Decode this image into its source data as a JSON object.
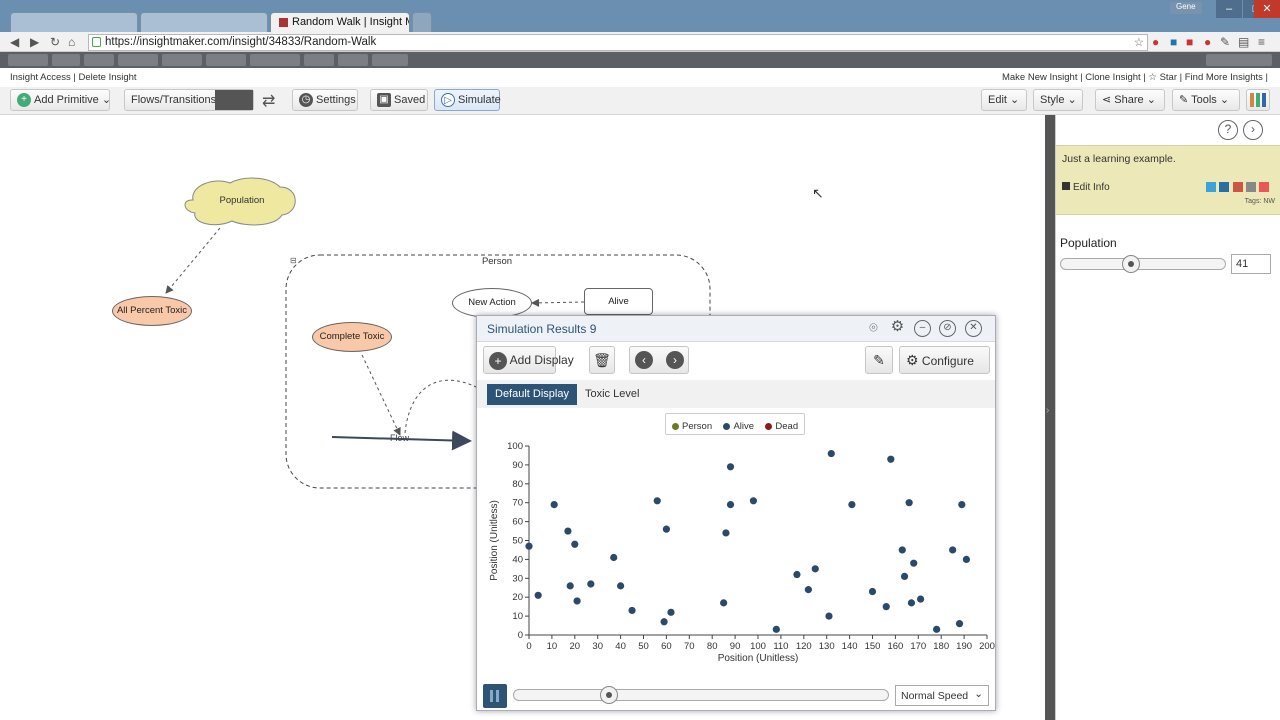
{
  "browser": {
    "tabs": [
      {
        "label": "",
        "active": false
      },
      {
        "label": "",
        "active": false
      },
      {
        "label": "Random Walk | Insight Ma",
        "active": true
      }
    ],
    "user_badge": "Gene",
    "url": "https://insightmaker.com/insight/34833/Random-Walk"
  },
  "app_links": {
    "left": "Insight Access | Delete Insight",
    "right": "Make New Insight | Clone Insight | ☆ Star | Find More Insights |"
  },
  "toolbar": {
    "add_primitive": "Add Primitive",
    "flows_transitions": "Flows/Transitions",
    "settings": "Settings",
    "saved": "Saved",
    "simulate": "Simulate",
    "edit": "Edit",
    "style": "Style",
    "share": "Share",
    "tools": "Tools"
  },
  "model": {
    "population": "Population",
    "all_percent_toxic": "All Percent Toxic",
    "person": "Person",
    "new_action": "New Action",
    "alive": "Alive",
    "complete_toxic": "Complete Toxic",
    "flow": "Flow"
  },
  "right_panel": {
    "description": "Just a learning example.",
    "edit_info": "Edit Info",
    "tags": "Tags: NW",
    "slider_label": "Population",
    "slider_value": "41",
    "slider_fraction": 0.41
  },
  "results": {
    "title": "Simulation Results 9",
    "add_display": "Add Display",
    "configure": "Configure",
    "tabs": [
      "Default Display",
      "Toxic Level"
    ],
    "speed": "Normal Speed",
    "progress_fraction": 0.24
  },
  "colors": {
    "person": "#6b7a1e",
    "alive": "#2b4a6b",
    "dead": "#8b1c1c",
    "population_fill": "#eee8a0",
    "toxic_fill": "#f9c8a8",
    "tab_active": "#2d5377"
  },
  "chart_data": {
    "type": "scatter",
    "title": "",
    "xlabel": "Position (Unitless)",
    "ylabel": "Position (Unitless)",
    "xlim": [
      0,
      200
    ],
    "ylim": [
      0,
      100
    ],
    "xticks": [
      0,
      10,
      20,
      30,
      40,
      50,
      60,
      70,
      80,
      90,
      100,
      110,
      120,
      130,
      140,
      150,
      160,
      170,
      180,
      190,
      200
    ],
    "yticks": [
      0,
      10,
      20,
      30,
      40,
      50,
      60,
      70,
      80,
      90,
      100
    ],
    "legend": [
      "Person",
      "Alive",
      "Dead"
    ],
    "legend_position": "top-center",
    "series": [
      {
        "name": "Alive",
        "points": [
          [
            0,
            47
          ],
          [
            4,
            21
          ],
          [
            11,
            69
          ],
          [
            17,
            55
          ],
          [
            18,
            26
          ],
          [
            20,
            48
          ],
          [
            21,
            18
          ],
          [
            27,
            27
          ],
          [
            37,
            41
          ],
          [
            40,
            26
          ],
          [
            45,
            13
          ],
          [
            56,
            71
          ],
          [
            59,
            7
          ],
          [
            60,
            56
          ],
          [
            62,
            12
          ],
          [
            85,
            17
          ],
          [
            86,
            54
          ],
          [
            88,
            89
          ],
          [
            88,
            69
          ],
          [
            98,
            71
          ],
          [
            108,
            3
          ],
          [
            117,
            32
          ],
          [
            122,
            24
          ],
          [
            125,
            35
          ],
          [
            131,
            10
          ],
          [
            132,
            96
          ],
          [
            141,
            69
          ],
          [
            150,
            23
          ],
          [
            156,
            15
          ],
          [
            158,
            93
          ],
          [
            163,
            45
          ],
          [
            164,
            31
          ],
          [
            166,
            70
          ],
          [
            167,
            17
          ],
          [
            168,
            38
          ],
          [
            171,
            19
          ],
          [
            178,
            3
          ],
          [
            185,
            45
          ],
          [
            188,
            6
          ],
          [
            189,
            69
          ],
          [
            191,
            40
          ]
        ]
      }
    ]
  }
}
